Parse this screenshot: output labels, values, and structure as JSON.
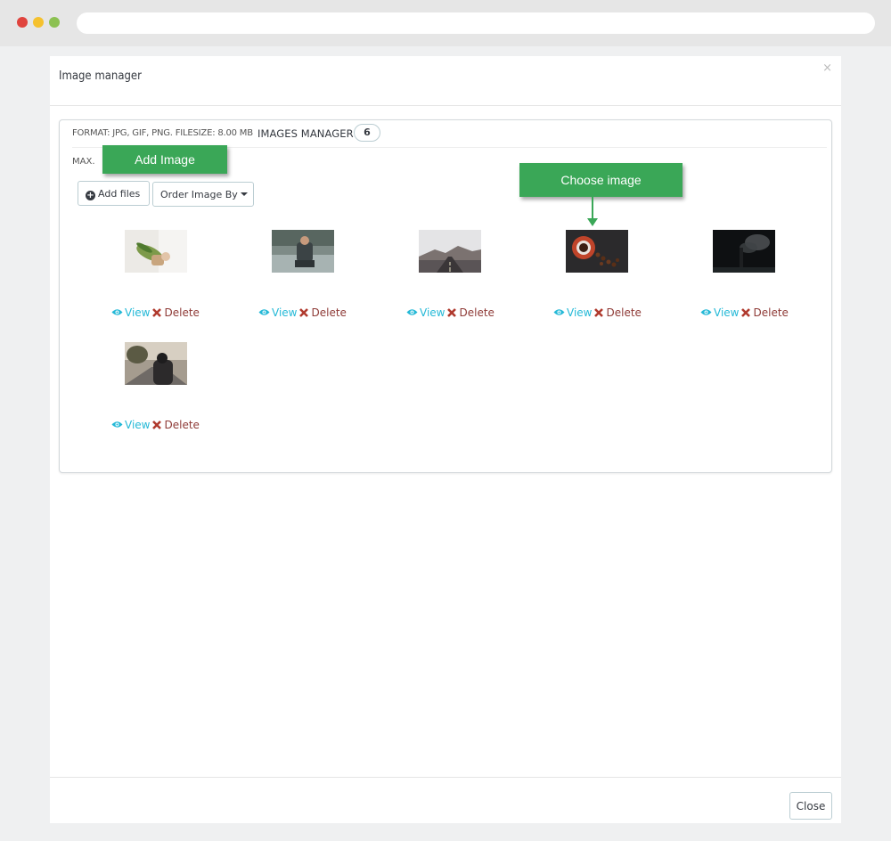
{
  "modal": {
    "title": "Image manager",
    "close_glyph": "×",
    "close_button": "Close"
  },
  "panel": {
    "format_text": "FORMAT: JPG, GIF, PNG. FILESIZE: 8.00 MB",
    "manager_title": "IMAGES MANAGER",
    "image_count": "6",
    "max_text": "MAX.",
    "add_files_label": "Add files",
    "order_label": "Order Image By"
  },
  "images": [
    {
      "view_label": "View",
      "delete_label": "Delete",
      "subject": "woman holding bouquet"
    },
    {
      "view_label": "View",
      "delete_label": "Delete",
      "subject": "man sitting by water"
    },
    {
      "view_label": "View",
      "delete_label": "Delete",
      "subject": "misty road"
    },
    {
      "view_label": "View",
      "delete_label": "Delete",
      "subject": "coffee beans cup"
    },
    {
      "view_label": "View",
      "delete_label": "Delete",
      "subject": "smoke tree dark"
    },
    {
      "view_label": "View",
      "delete_label": "Delete",
      "subject": "person on road"
    }
  ],
  "callouts": {
    "add_image": "Add Image",
    "choose_image": "Choose image"
  },
  "colors": {
    "callout_green": "#3aa757",
    "view_link": "#25b9d7",
    "delete_link": "#8e3a36"
  }
}
